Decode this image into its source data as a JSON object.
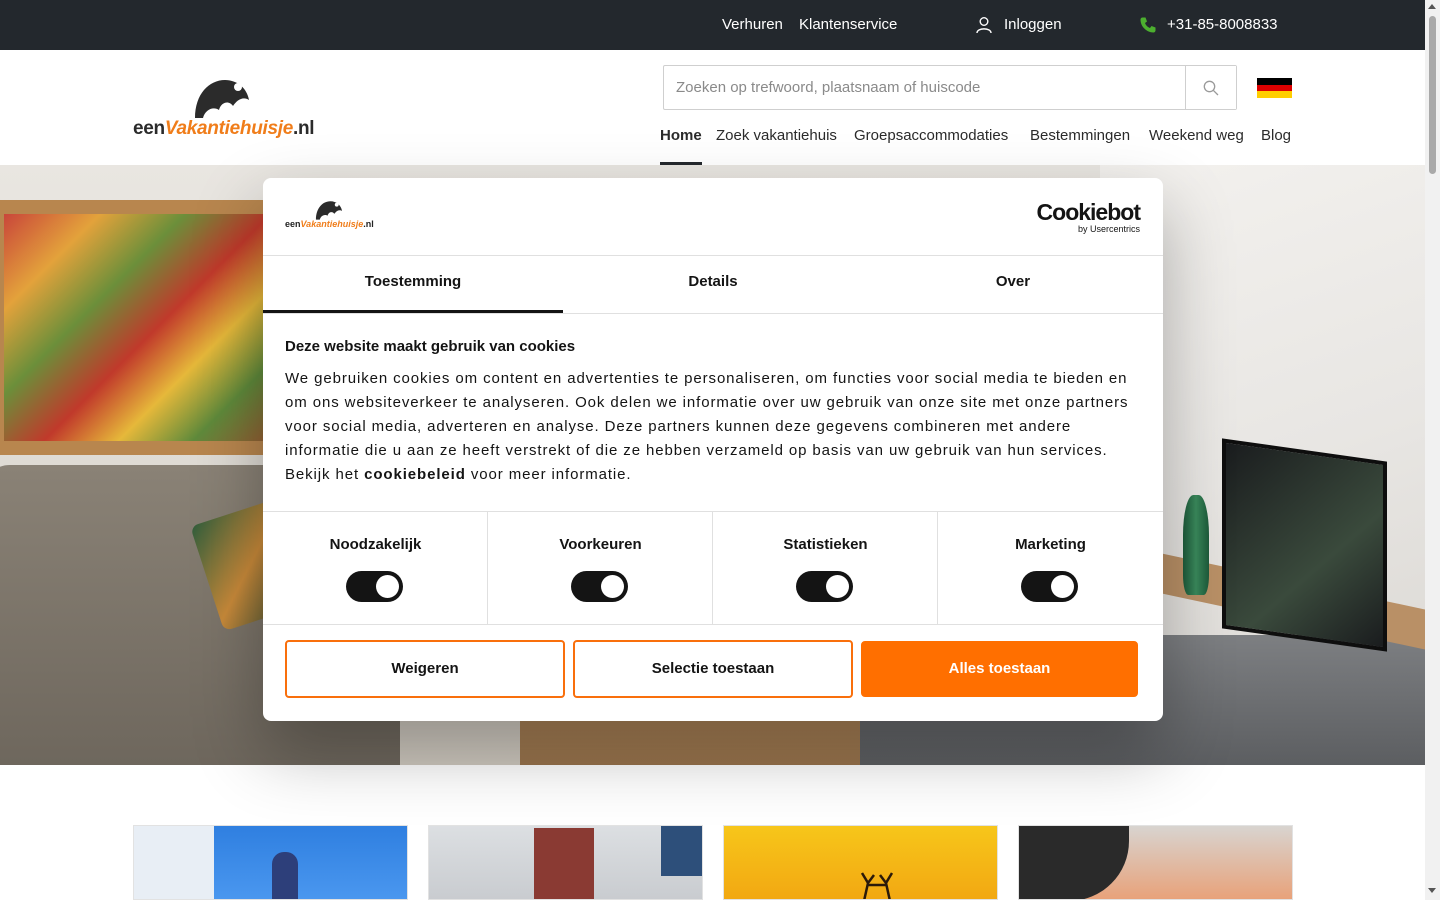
{
  "topbar": {
    "verhuren": "Verhuren",
    "klantenservice": "Klantenservice",
    "inloggen": "Inloggen",
    "phone": "+31-85-8008833"
  },
  "header": {
    "logo_prefix": "een",
    "logo_middle": "Vakantiehuisje",
    "logo_suffix": ".nl",
    "search_placeholder": "Zoeken op trefwoord, plaatsnaam of huiscode",
    "nav": [
      "Home",
      "Zoek vakantiehuis",
      "Groepsaccommodaties",
      "Bestemmingen",
      "Weekend weg",
      "Blog"
    ]
  },
  "cookie": {
    "brand_main": "Cookiebot",
    "brand_sub": "by Usercentrics",
    "tabs": [
      "Toestemming",
      "Details",
      "Over"
    ],
    "title": "Deze website maakt gebruik van cookies",
    "text_before": "We gebruiken cookies om content en advertenties te personaliseren, om functies voor social media te bieden en om ons websiteverkeer te analyseren. Ook delen we informatie over uw gebruik van onze site met onze partners voor social media, adverteren en analyse. Deze partners kunnen deze gegevens combineren met andere informatie die u aan ze heeft verstrekt of die ze hebben verzameld op basis van uw gebruik van hun services. Bekijk het ",
    "link": "cookiebeleid",
    "text_after": " voor meer informatie.",
    "categories": [
      "Noodzakelijk",
      "Voorkeuren",
      "Statistieken",
      "Marketing"
    ],
    "buttons": {
      "deny": "Weigeren",
      "selection": "Selectie toestaan",
      "allow_all": "Alles toestaan"
    }
  },
  "colors": {
    "topbar_bg": "#23282d",
    "accent_orange": "#ff6f00",
    "phone_green": "#4caf2f"
  }
}
